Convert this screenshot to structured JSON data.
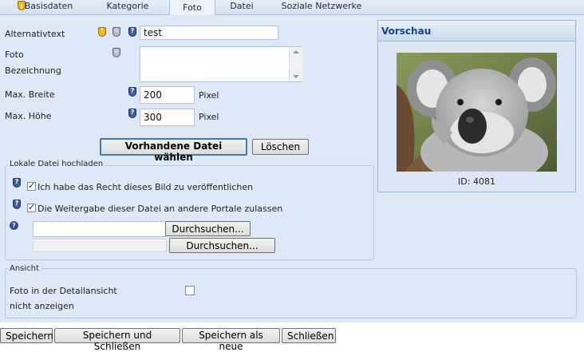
{
  "tabs": [
    {
      "label": "Basisdaten"
    },
    {
      "label": "Kategorie"
    },
    {
      "label": "Foto"
    },
    {
      "label": "Datei"
    },
    {
      "label": "Soziale Netzwerke"
    }
  ],
  "form": {
    "alt_label": "Alternativtext",
    "alt_value": "test",
    "desc_label_1": "Foto",
    "desc_label_2": "Bezeichnung",
    "desc_value": "",
    "maxw_label": "Max. Breite",
    "maxw_value": "200",
    "maxh_label": "Max. Höhe",
    "maxh_value": "300",
    "unit": "Pixel",
    "choose_button": "Vorhandene Datei wählen",
    "delete_button": "Löschen"
  },
  "upload": {
    "legend": "Lokale Datei hochladen",
    "rights_label": "Ich habe das Recht dieses Bild zu veröffentlichen",
    "rights_checked": true,
    "share_label": "Die Weitergabe dieser Datei an andere Portale zulassen",
    "share_checked": true,
    "file1_value": "",
    "file2_value": "",
    "browse1": "Durchsuchen...",
    "browse2": "Durchsuchen..."
  },
  "view": {
    "legend": "Ansicht",
    "hide_label_1": "Foto in der Detailansicht",
    "hide_label_2": "nicht anzeigen",
    "hide_checked": false
  },
  "preview": {
    "title": "Vorschau",
    "id_text": "ID: 4081"
  },
  "footer": {
    "save": "Speichern",
    "save_close": "Speichern und Schließen",
    "save_new": "Speichern als neue",
    "close": "Schließen"
  },
  "colors": {
    "panel": "#dfe8f6",
    "header_text": "#15428b",
    "accent": "#3c7fb1"
  }
}
